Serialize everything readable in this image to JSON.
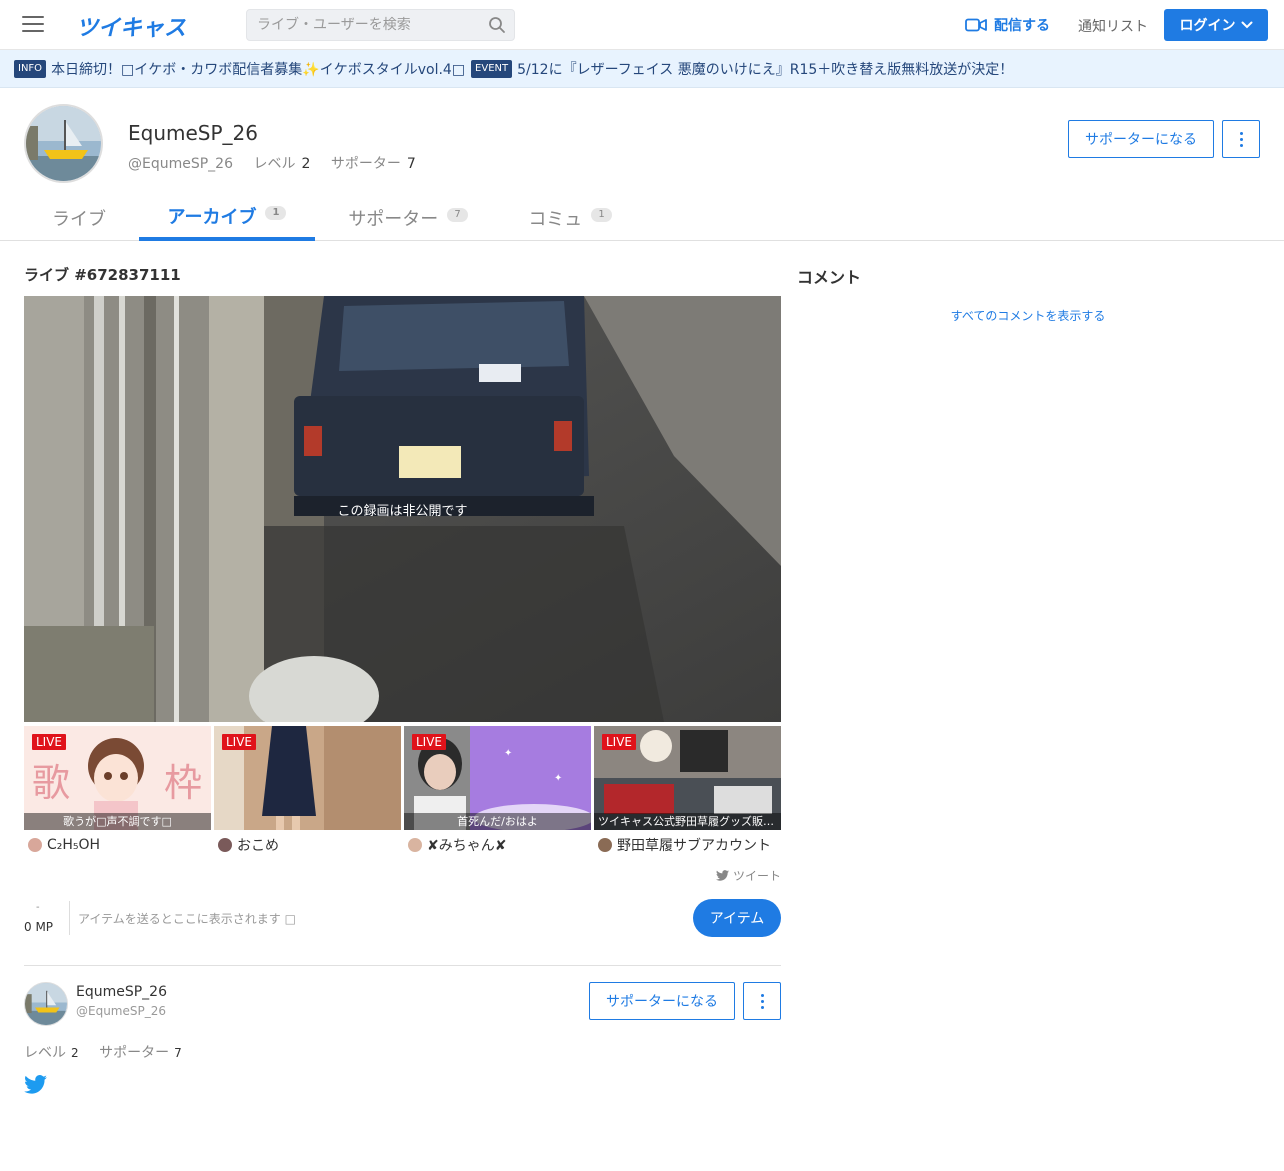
{
  "header": {
    "logo": "ツイキャス",
    "search_placeholder": "ライブ・ユーザーを検索",
    "broadcast_label": "配信する",
    "notify_label": "通知リスト",
    "login_label": "ログイン"
  },
  "infobar": {
    "items": [
      {
        "badge": "INFO",
        "text": "本日締切！□イケボ・カワボ配信者募集✨イケボスタイルvol.4□"
      },
      {
        "badge": "EVENT",
        "text": "5/12に『レザーフェイス 悪魔のいけにえ』R15＋吹き替え版無料放送が決定！"
      }
    ]
  },
  "profile": {
    "name": "EqumeSP_26",
    "handle": "@EqumeSP_26",
    "level_label": "レベル",
    "level": "2",
    "supporter_label": "サポーター",
    "supporters": "7",
    "become_supporter": "サポーターになる"
  },
  "tabs": [
    {
      "label": "ライブ",
      "count": ""
    },
    {
      "label": "アーカイブ",
      "count": "1",
      "active": true
    },
    {
      "label": "サポーター",
      "count": "7"
    },
    {
      "label": "コミュ",
      "count": "1"
    }
  ],
  "main": {
    "live_title": "ライブ #672837111",
    "video_message": "この録画は非公開です",
    "comment_title": "コメント",
    "show_all_comments": "すべてのコメントを表示する",
    "tweet_label": "ツイート",
    "mp_dash": "-",
    "mp_value": "0 MP",
    "item_hint": "アイテムを送るとここに表示されます □",
    "item_button": "アイテム"
  },
  "recommended": [
    {
      "badge": "LIVE",
      "caption": "歌うが□声不調です□",
      "user": "C₂H₅OH"
    },
    {
      "badge": "LIVE",
      "caption": "",
      "user": "おこめ"
    },
    {
      "badge": "LIVE",
      "caption": "首死んだ/おはよ",
      "user": "✘みちゃん✘"
    },
    {
      "badge": "LIVE",
      "caption": "ツイキャス公式野田草履グッズ販売…",
      "user": "野田草履サブアカウント"
    }
  ],
  "broadcaster": {
    "name": "EqumeSP_26",
    "handle": "@EqumeSP_26",
    "level_label": "レベル",
    "level": "2",
    "supporter_label": "サポーター",
    "supporters": "7",
    "become_supporter": "サポーターになる"
  },
  "colors": {
    "accent": "#1f7be3",
    "live_badge": "#e0131b",
    "info_bg": "#e8f3fe",
    "info_text": "#25477b"
  }
}
